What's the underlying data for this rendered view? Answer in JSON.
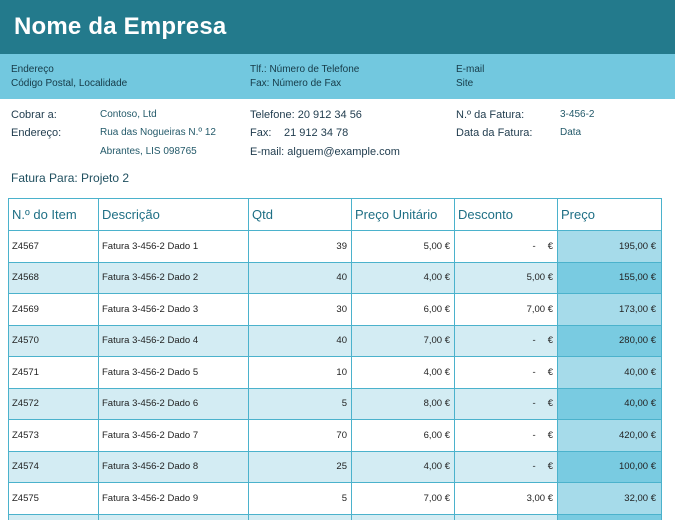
{
  "company": {
    "name": "Nome da Empresa"
  },
  "contact": {
    "address_line1": "Endereço",
    "address_line2": "Código Postal, Localidade",
    "phone": "Tlf.: Número de Telefone",
    "fax": "Fax: Número de Fax",
    "email": "E-mail",
    "site": "Site"
  },
  "billing": {
    "bill_to_label": "Cobrar a:",
    "bill_to_value": "Contoso, Ltd",
    "address_label": "Endereço:",
    "address_line1": "Rua das Nogueiras N.º 12",
    "address_line2": "Abrantes, LIS 098765",
    "phone": "Telefone: 20 912 34 56",
    "fax_label": "Fax:",
    "fax_value": "21 912 34 78",
    "email": "E-mail: alguem@example.com",
    "invoice_no_label": "N.º da Fatura:",
    "invoice_no_value": "3-456-2",
    "invoice_date_label": "Data da Fatura:",
    "invoice_date_value": "Data"
  },
  "fatura_para": "Fatura Para: Projeto 2",
  "table": {
    "headers": [
      "N.º do Item",
      "Descrição",
      "Qtd",
      "Preço Unitário",
      "Desconto",
      "Preço"
    ],
    "rows": [
      {
        "item": "Z4567",
        "desc": "Fatura 3-456-2 Dado 1",
        "qty": "39",
        "unit": "5,00 €",
        "disc": "-",
        "disc_sym": "€",
        "price": "195,00 €"
      },
      {
        "item": "Z4568",
        "desc": "Fatura 3-456-2 Dado 2",
        "qty": "40",
        "unit": "4,00 €",
        "disc": "5,00 €",
        "disc_sym": "",
        "price": "155,00 €"
      },
      {
        "item": "Z4569",
        "desc": "Fatura 3-456-2 Dado 3",
        "qty": "30",
        "unit": "6,00 €",
        "disc": "7,00 €",
        "disc_sym": "",
        "price": "173,00 €"
      },
      {
        "item": "Z4570",
        "desc": "Fatura 3-456-2 Dado 4",
        "qty": "40",
        "unit": "7,00 €",
        "disc": "-",
        "disc_sym": "€",
        "price": "280,00 €"
      },
      {
        "item": "Z4571",
        "desc": "Fatura 3-456-2 Dado 5",
        "qty": "10",
        "unit": "4,00 €",
        "disc": "-",
        "disc_sym": "€",
        "price": "40,00 €"
      },
      {
        "item": "Z4572",
        "desc": "Fatura 3-456-2 Dado 6",
        "qty": "5",
        "unit": "8,00 €",
        "disc": "-",
        "disc_sym": "€",
        "price": "40,00 €"
      },
      {
        "item": "Z4573",
        "desc": "Fatura 3-456-2 Dado 7",
        "qty": "70",
        "unit": "6,00 €",
        "disc": "-",
        "disc_sym": "€",
        "price": "420,00 €"
      },
      {
        "item": "Z4574",
        "desc": "Fatura 3-456-2 Dado 8",
        "qty": "25",
        "unit": "4,00 €",
        "disc": "-",
        "disc_sym": "€",
        "price": "100,00 €"
      },
      {
        "item": "Z4575",
        "desc": "Fatura 3-456-2 Dado 9",
        "qty": "5",
        "unit": "7,00 €",
        "disc": "3,00 €",
        "disc_sym": "",
        "price": "32,00 €"
      },
      {
        "item": "",
        "desc": "",
        "qty": "",
        "unit": "",
        "disc": "",
        "disc_sym": "",
        "price": ""
      }
    ]
  },
  "colors": {
    "header": "#237a8c",
    "contact_bar": "#72c8df",
    "row_alt": "#d3ecf3",
    "price_col": "#a6dbea",
    "price_col_alt": "#79cbe1"
  }
}
